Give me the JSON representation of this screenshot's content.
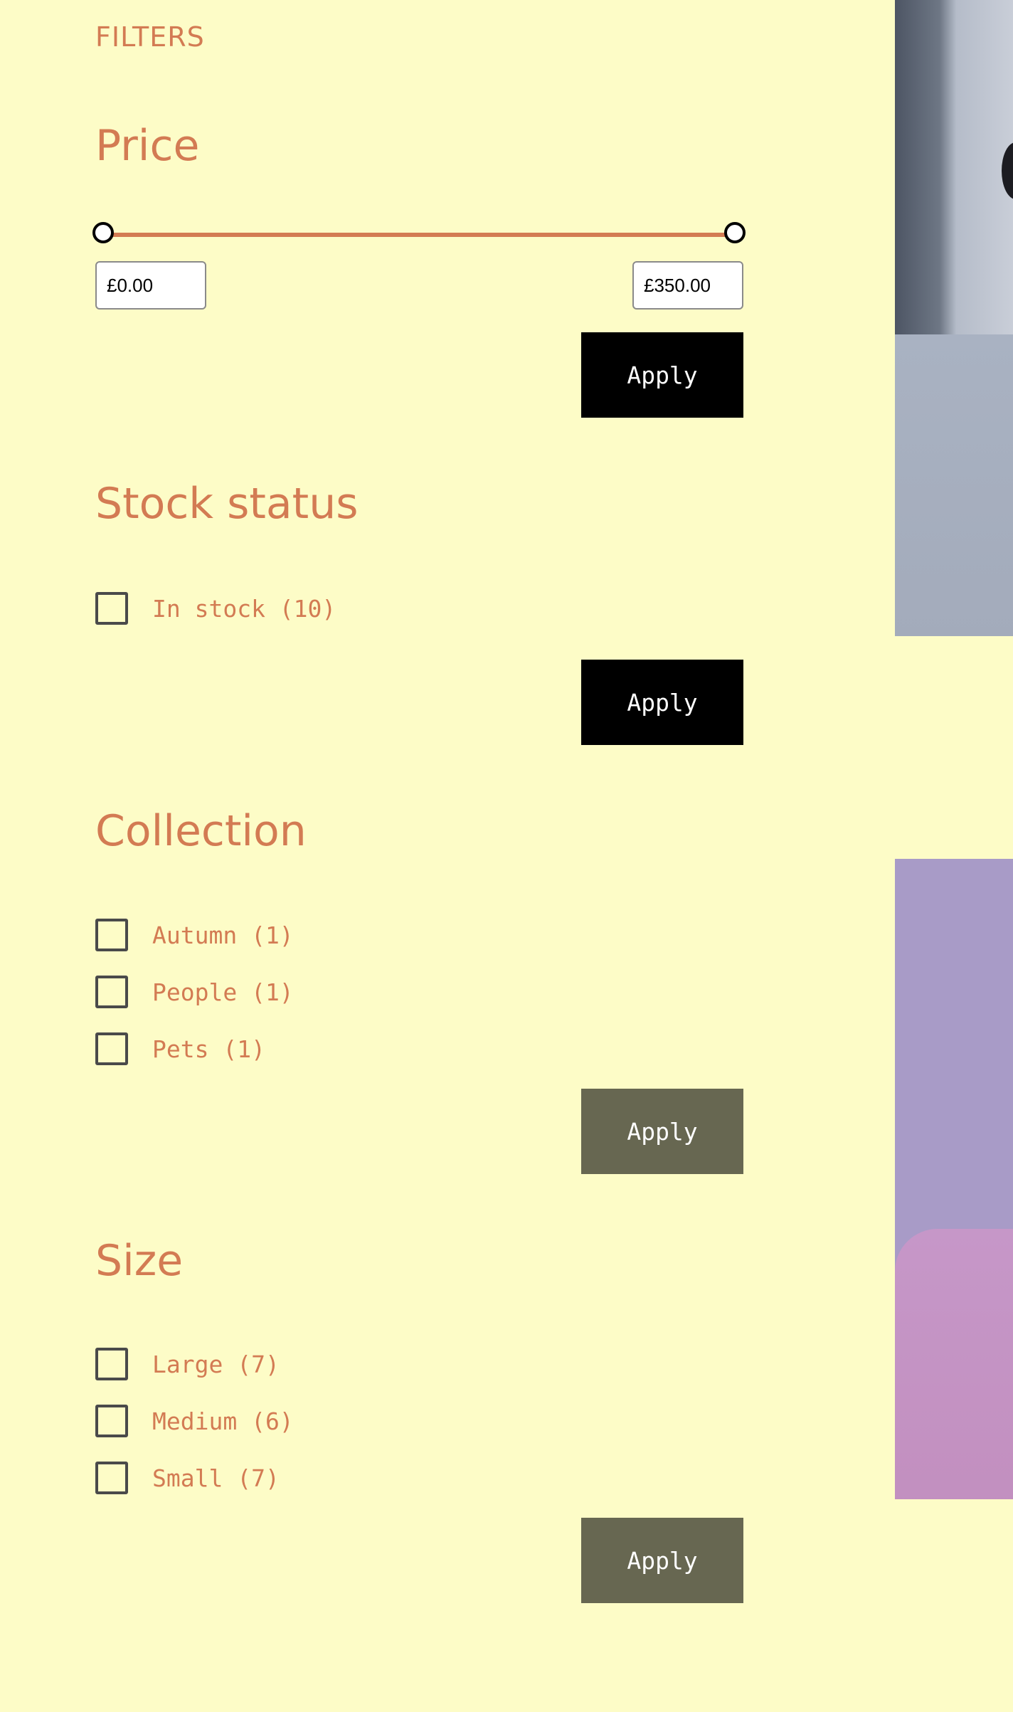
{
  "filters": {
    "title": "FILTERS",
    "apply_label": "Apply",
    "price": {
      "heading": "Price",
      "min_value": "£0.00",
      "max_value": "£350.00",
      "range_min_fraction": 0,
      "range_max_fraction": 1
    },
    "stock_status": {
      "heading": "Stock status",
      "options": [
        {
          "label": "In stock (10)",
          "checked": false
        }
      ]
    },
    "collection": {
      "heading": "Collection",
      "options": [
        {
          "label": "Autumn (1)",
          "checked": false
        },
        {
          "label": "People (1)",
          "checked": false
        },
        {
          "label": "Pets (1)",
          "checked": false
        }
      ]
    },
    "size": {
      "heading": "Size",
      "options": [
        {
          "label": "Large (7)",
          "checked": false
        },
        {
          "label": "Medium (6)",
          "checked": false
        },
        {
          "label": "Small (7)",
          "checked": false
        }
      ]
    }
  },
  "colors": {
    "background": "#fdfcc7",
    "accent": "#d37b53",
    "button_dark": "#000000",
    "button_muted": "#676751"
  }
}
